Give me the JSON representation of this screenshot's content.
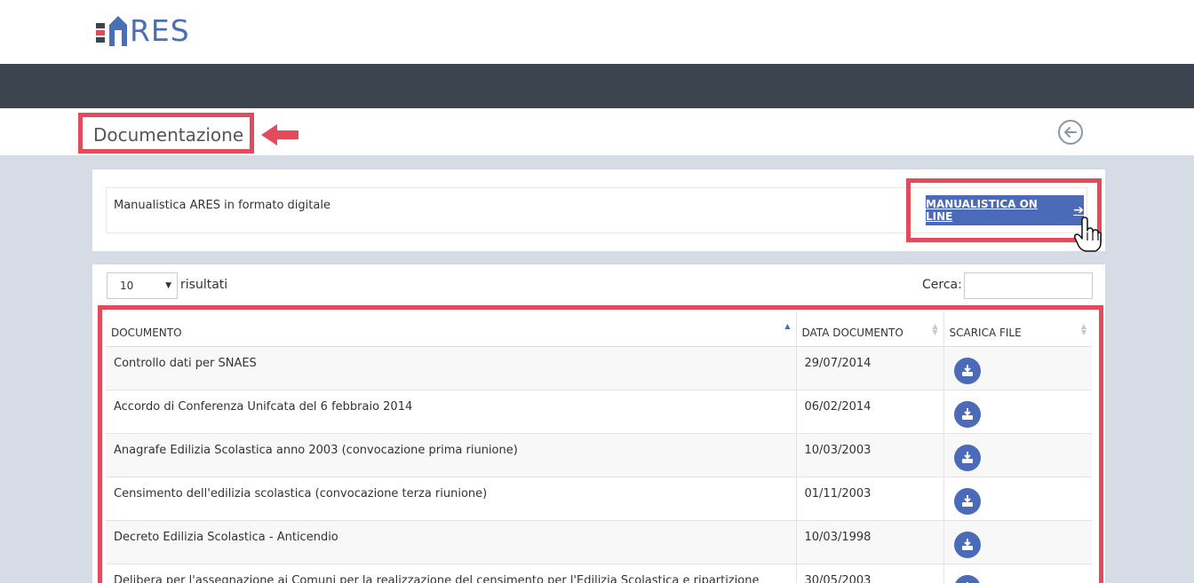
{
  "app": {
    "logo_text": "RES",
    "colors": {
      "accent": "#4b6ab7",
      "highlight": "#e14b5b",
      "navbar": "#3b444f"
    }
  },
  "page": {
    "title": "Documentazione",
    "back_icon": "arrow-left-circle-icon"
  },
  "manual_panel": {
    "text": "Manualistica ARES in formato digitale",
    "button_label": "MANUALISTICA ON LINE",
    "button_icon": "arrow-right-icon"
  },
  "table_controls": {
    "page_length": "10",
    "page_length_label": "risultati",
    "search_label": "Cerca:",
    "search_value": ""
  },
  "table": {
    "headers": [
      "DOCUMENTO",
      "DATA DOCUMENTO",
      "SCARICA FILE"
    ],
    "rows": [
      {
        "doc": "Controllo dati per SNAES",
        "date": "29/07/2014"
      },
      {
        "doc": "Accordo di Conferenza Unifcata del 6 febbraio 2014",
        "date": "06/02/2014"
      },
      {
        "doc": "Anagrafe Edilizia Scolastica anno 2003 (convocazione prima riunione)",
        "date": "10/03/2003"
      },
      {
        "doc": "Censimento dell'edilizia scolastica (convocazione terza riunione)",
        "date": "01/11/2003"
      },
      {
        "doc": "Decreto Edilizia Scolastica - Anticendio",
        "date": "10/03/1998"
      },
      {
        "doc": "Delibera per l'assegnazione ai Comuni per la realizzazione del censimento per l'Edilizia Scolastica e ripartizione fondi",
        "date": "30/05/2003"
      }
    ]
  }
}
